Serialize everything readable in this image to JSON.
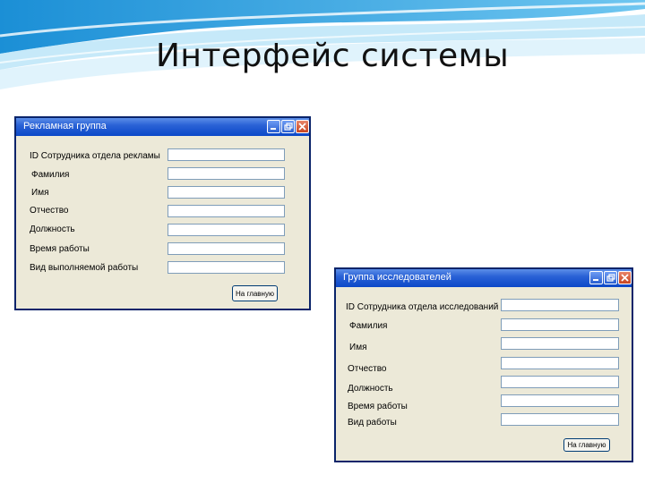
{
  "slide": {
    "title": "Интерфейс системы"
  },
  "window_ad": {
    "title": "Рекламная группа",
    "fields": [
      {
        "label": "ID Сотрудника отдела рекламы",
        "value": ""
      },
      {
        "label": "Фамилия",
        "value": ""
      },
      {
        "label": "Имя",
        "value": ""
      },
      {
        "label": "Отчество",
        "value": ""
      },
      {
        "label": "Должность",
        "value": ""
      },
      {
        "label": "Время работы",
        "value": ""
      },
      {
        "label": "Вид выполняемой работы",
        "value": ""
      }
    ],
    "home_button": "На главную"
  },
  "window_research": {
    "title": "Группа исследователей",
    "fields": [
      {
        "label": "ID Сотрудника отдела исследований",
        "value": ""
      },
      {
        "label": "Фамилия",
        "value": ""
      },
      {
        "label": "Имя",
        "value": ""
      },
      {
        "label": "Отчество",
        "value": ""
      },
      {
        "label": "Должность",
        "value": ""
      },
      {
        "label": "Время работы",
        "value": ""
      },
      {
        "label": "Вид работы",
        "value": ""
      }
    ],
    "home_button": "На главную"
  }
}
